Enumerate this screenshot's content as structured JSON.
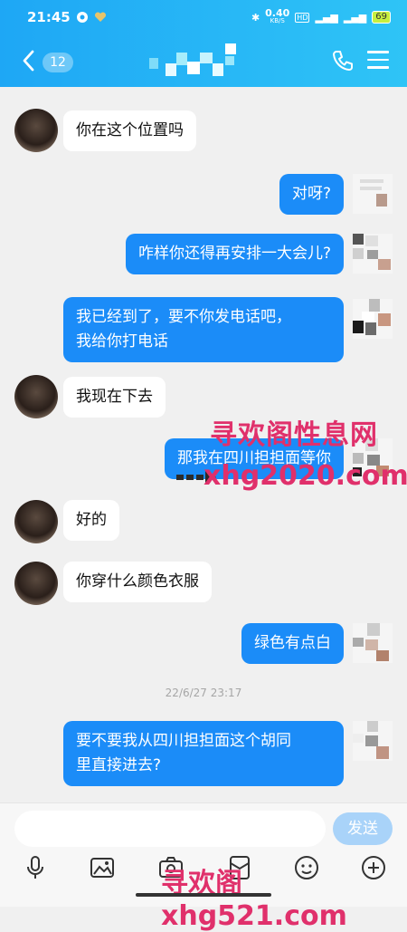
{
  "status_bar": {
    "time": "21:45",
    "speed": "0.40",
    "speed_unit": "KB/S",
    "hd": "HD",
    "battery": "69"
  },
  "header": {
    "unread_count": "12"
  },
  "messages": [
    {
      "side": "in",
      "text": "你在这个位置吗"
    },
    {
      "side": "out",
      "text": "对呀?"
    },
    {
      "side": "out",
      "text": "咋样你还得再安排一大会儿?"
    },
    {
      "side": "out",
      "text": "我已经到了，要不你发电话吧，\n我给你打电话"
    },
    {
      "side": "in",
      "text": "我现在下去"
    },
    {
      "side": "out",
      "text": "那我在四川担担面等你"
    },
    {
      "side": "in",
      "text": "好的"
    },
    {
      "side": "in",
      "text": "你穿什么颜色衣服"
    },
    {
      "side": "out",
      "text": "绿色有点白"
    },
    {
      "side": "out",
      "text": "要不要我从四川担担面这个胡同\n里直接进去?"
    }
  ],
  "timestamp": "22/6/27 23:17",
  "input": {
    "placeholder": "",
    "send_label": "发送"
  },
  "watermarks": {
    "top": "寻欢阁性息网",
    "middle": "xhg2020.com",
    "bottom": "寻欢阁xhg521.com"
  },
  "colors": {
    "header_start": "#1ea7f5",
    "header_end": "#2fc4f6",
    "outgoing_bubble": "#1b8cf8",
    "incoming_bubble": "#ffffff",
    "send_button": "#a9d3f9",
    "watermark": "#e0306b"
  },
  "icons": {
    "back": "chevron-left-icon",
    "call": "phone-icon",
    "menu": "menu-icon",
    "toolbar": [
      "microphone-icon",
      "image-icon",
      "camera-icon",
      "red-packet-icon",
      "emoji-icon",
      "plus-icon"
    ]
  }
}
